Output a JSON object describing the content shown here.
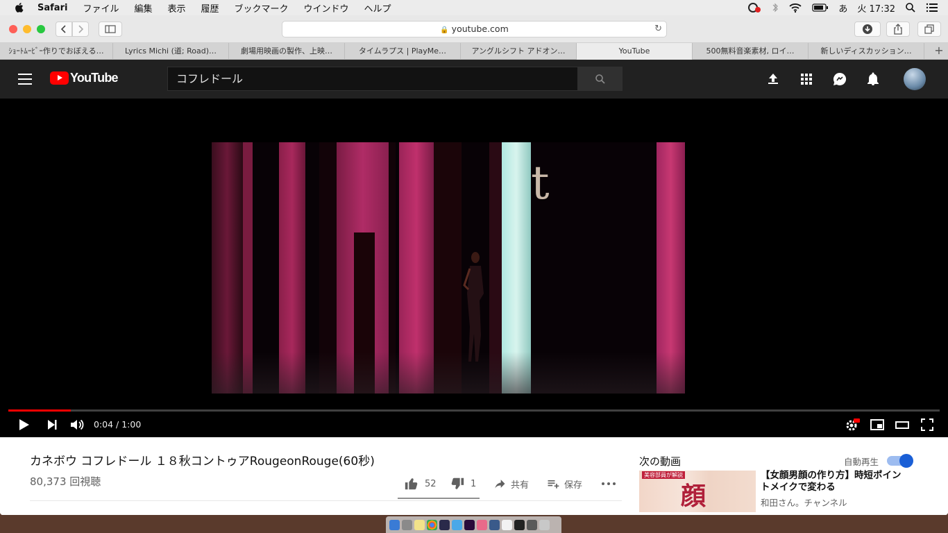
{
  "menubar": {
    "app_name": "Safari",
    "items": [
      "ファイル",
      "編集",
      "表示",
      "履歴",
      "ブックマーク",
      "ウインドウ",
      "ヘルプ"
    ],
    "input_method": "あ",
    "clock": "火 17:32"
  },
  "browser": {
    "url": "youtube.com",
    "tabs": [
      {
        "label": "ｼｮｰﾄﾑｰﾋﾞｰ作りでおぼえる…",
        "active": false
      },
      {
        "label": "Lyrics Michi (道; Road)…",
        "active": false
      },
      {
        "label": "劇場用映画の製作、上映…",
        "active": false
      },
      {
        "label": "タイムラプス | PlayMe…",
        "active": false
      },
      {
        "label": "アングルシフト アドオン…",
        "active": false
      },
      {
        "label": "YouTube",
        "active": true
      },
      {
        "label": "500無料音楽素材, ロイ…",
        "active": false
      },
      {
        "label": "新しいディスカッション…",
        "active": false
      }
    ],
    "new_tab_label": "+"
  },
  "youtube": {
    "logo_text": "YouTube",
    "search_value": "コフレドール",
    "player": {
      "time_display": "0:04 / 1:00",
      "progress": 0.067,
      "overlay_letter": "t"
    },
    "video": {
      "title": "カネボウ コフレドール １８秋コントゥアRougeonRouge(60秒)",
      "views": "80,373 回視聴",
      "likes": "52",
      "dislikes": "1",
      "share_label": "共有",
      "save_label": "保存"
    },
    "sidebar": {
      "next_heading": "次の動画",
      "autoplay_label": "自動再生",
      "autoplay_on": true,
      "recommendations": [
        {
          "title": "【女顔男顔の作り方】時短ポイントメイクで変わる",
          "channel": "和田さん。チャンネル",
          "thumb_text": "顔",
          "thumb_tag": "美容部員が解説"
        }
      ]
    }
  },
  "colors": {
    "yt_red": "#ff0000",
    "yt_header": "#212121",
    "toggle_blue": "#1a5fd6"
  }
}
